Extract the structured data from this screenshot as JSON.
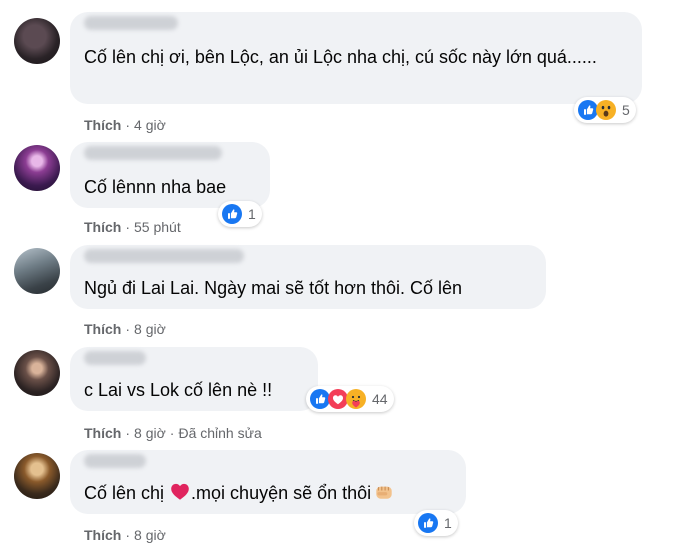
{
  "comments": [
    {
      "text": "Cố lên chị ơi, bên Lộc, an ủi Lộc nha chị, cú sốc này lớn quá......",
      "like_label": "Thích",
      "time": "4 giờ",
      "reaction_count": "5",
      "reaction_icons": [
        "like-icon",
        "wow-icon"
      ]
    },
    {
      "text": "Cố lênnn nha bae",
      "like_label": "Thích",
      "time": "55 phút",
      "reaction_count": "1",
      "reaction_icons": [
        "like-icon"
      ]
    },
    {
      "text": "Ngủ đi Lai Lai. Ngày mai sẽ tốt hơn thôi. Cố lên",
      "like_label": "Thích",
      "time": "8 giờ"
    },
    {
      "text": "c Lai vs Lok cố lên nè !!",
      "like_label": "Thích",
      "time": "8 giờ",
      "edited": "Đã chỉnh sửa",
      "reaction_count": "44",
      "reaction_icons": [
        "like-icon",
        "love-icon",
        "care-icon"
      ]
    },
    {
      "text_before": "Cố lên chị ",
      "text_after": ".mọi chuyện sẽ ổn thôi",
      "inline_emoji": [
        "heart-icon",
        "fist-icon"
      ],
      "like_label": "Thích",
      "time": "8 giờ",
      "reaction_count": "1",
      "reaction_icons": [
        "like-icon"
      ]
    }
  ],
  "colors": {
    "bubble": "#f0f2f5",
    "meta_text": "#65676b",
    "like_blue": "#1877f2",
    "love_red": "#f33e58",
    "wow_yellow": "#f7b125"
  }
}
